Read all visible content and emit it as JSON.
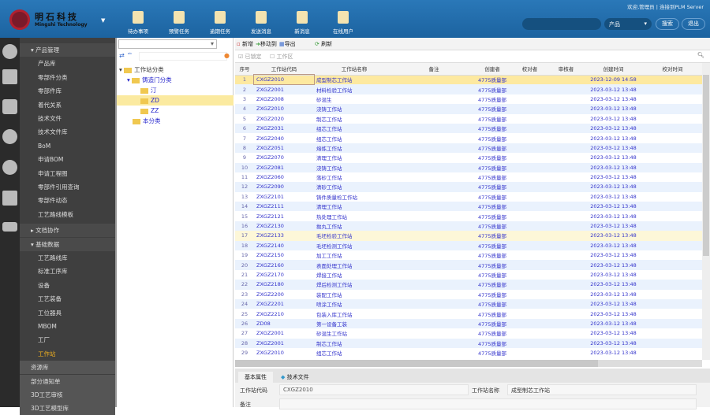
{
  "header": {
    "brand_cn": "明石科技",
    "brand_en": "Mingshi Technology",
    "welcome": "欢迎,管理员 | 连接到PLM Server",
    "toolbar": [
      {
        "label": "待办事项",
        "icon": "todo-icon"
      },
      {
        "label": "预警任务",
        "icon": "warning-doc-icon"
      },
      {
        "label": "逾期任务",
        "icon": "overdue-doc-icon"
      },
      {
        "label": "发送消息",
        "icon": "send-mail-icon"
      },
      {
        "label": "新消息",
        "icon": "new-mail-icon"
      },
      {
        "label": "在线用户",
        "icon": "users-icon"
      }
    ],
    "search_placeholder": "",
    "search_scope": "产品",
    "search_btn": "搜索",
    "exit_btn": "退出"
  },
  "menu": {
    "g1": "产品管理",
    "g1_items": [
      "产品库",
      "零部件分类",
      "零部件库",
      "着代关系",
      "技术文件",
      "技术文件库",
      "BoM",
      "申请BOM",
      "申请工程图",
      "零部件引用查询",
      "零部件动态",
      "工艺路线模板"
    ],
    "g2": "文档协作",
    "g3": "基础数据",
    "g3_items": [
      "工艺路线库",
      "标准工序库",
      "设备",
      "工艺装备",
      "工位器具",
      "MBOM",
      "工厂",
      "工作站"
    ],
    "g3_selected": "工作站",
    "g4_items": [
      "资源库",
      "部分通知单",
      "3D工艺审核",
      "3D工艺模型库"
    ]
  },
  "tree": {
    "root": "工作站分类",
    "child": "铸造门分类",
    "leaves": [
      "汀",
      "ZD",
      "ZZ"
    ],
    "selected": "ZD",
    "other": "本分类"
  },
  "toolbar": {
    "add": "新增",
    "delete": "移动到",
    "export": "导出",
    "refresh": "刷新",
    "chk1": "已锁定",
    "chk2": "工作区"
  },
  "table": {
    "columns": [
      "序号",
      "工作站代码",
      "工作站名称",
      "备注",
      "创建者",
      "校对者",
      "审核者",
      "创建时间",
      "校对时间"
    ],
    "rows": [
      [
        "1",
        "CXGZ2010",
        "成型制芯工作站",
        "",
        "4775质量部",
        "",
        "",
        "2023-12-09 14:58",
        ""
      ],
      [
        "2",
        "ZXGZ2001",
        "材料检验工作站",
        "",
        "4775质量部",
        "",
        "",
        "2023-03-12 13:48",
        ""
      ],
      [
        "3",
        "ZXGZ2008",
        "砂混生",
        "",
        "4775质量部",
        "",
        "",
        "2023-03-12 13:48",
        ""
      ],
      [
        "4",
        "ZXGZ2010",
        "浇铸工作站",
        "",
        "4775质量部",
        "",
        "",
        "2023-03-12 13:48",
        ""
      ],
      [
        "5",
        "ZXGZ2020",
        "制芯工作站",
        "",
        "4775质量部",
        "",
        "",
        "2023-03-12 13:48",
        ""
      ],
      [
        "6",
        "ZXGZ2031",
        "组芯工作站",
        "",
        "4775质量部",
        "",
        "",
        "2023-03-12 13:48",
        ""
      ],
      [
        "7",
        "ZXGZ2040",
        "组芯工作站",
        "",
        "4775质量部",
        "",
        "",
        "2023-03-12 13:48",
        ""
      ],
      [
        "8",
        "ZXGZ2051",
        "熔炼工作站",
        "",
        "4775质量部",
        "",
        "",
        "2023-03-12 13:48",
        ""
      ],
      [
        "9",
        "ZXGZ2070",
        "清理工作站",
        "",
        "4775质量部",
        "",
        "",
        "2023-03-12 13:48",
        ""
      ],
      [
        "10",
        "ZXGZ2081",
        "浇铸工作站",
        "",
        "4775质量部",
        "",
        "",
        "2023-03-12 13:48",
        ""
      ],
      [
        "11",
        "ZXGZ2060",
        "落砂工作站",
        "",
        "4775质量部",
        "",
        "",
        "2023-03-12 13:48",
        ""
      ],
      [
        "12",
        "ZXGZ2090",
        "清砂工作站",
        "",
        "4775质量部",
        "",
        "",
        "2023-03-12 13:48",
        ""
      ],
      [
        "13",
        "ZXGZ2101",
        "铸件质量检工作站",
        "",
        "4775质量部",
        "",
        "",
        "2023-03-12 13:48",
        ""
      ],
      [
        "14",
        "ZXGZ2111",
        "清理工作站",
        "",
        "4775质量部",
        "",
        "",
        "2023-03-12 13:48",
        ""
      ],
      [
        "15",
        "ZXGZ2121",
        "热处理工作站",
        "",
        "4775质量部",
        "",
        "",
        "2023-03-12 13:48",
        ""
      ],
      [
        "16",
        "ZXGZ2130",
        "抛丸工作站",
        "",
        "4775质量部",
        "",
        "",
        "2023-03-12 13:48",
        ""
      ],
      [
        "17",
        "ZXGZ2133",
        "毛坯检验工作站",
        "",
        "4775质量部",
        "",
        "",
        "2023-03-12 13:48",
        ""
      ],
      [
        "18",
        "ZXGZ2140",
        "毛坯检测工作站",
        "",
        "4775质量部",
        "",
        "",
        "2023-03-12 13:48",
        ""
      ],
      [
        "19",
        "ZXGZ2150",
        "加工工作站",
        "",
        "4775质量部",
        "",
        "",
        "2023-03-12 13:48",
        ""
      ],
      [
        "20",
        "ZXGZ2160",
        "表面处理工作站",
        "",
        "4775质量部",
        "",
        "",
        "2023-03-12 13:48",
        ""
      ],
      [
        "21",
        "ZXGZ2170",
        "焊接工作站",
        "",
        "4775质量部",
        "",
        "",
        "2023-03-12 13:48",
        ""
      ],
      [
        "22",
        "ZXGZ2180",
        "焊后检测工作站",
        "",
        "4775质量部",
        "",
        "",
        "2023-03-12 13:48",
        ""
      ],
      [
        "23",
        "ZXGZ2200",
        "装配工作站",
        "",
        "4775质量部",
        "",
        "",
        "2023-03-12 13:48",
        ""
      ],
      [
        "24",
        "ZXGZ2201",
        "喷涂工作站",
        "",
        "4775质量部",
        "",
        "",
        "2023-03-12 13:48",
        ""
      ],
      [
        "25",
        "ZXGZ2210",
        "包装入库工作站",
        "",
        "4775质量部",
        "",
        "",
        "2023-03-12 13:48",
        ""
      ],
      [
        "26",
        "ZD08",
        "第一设备工装",
        "",
        "4775质量部",
        "",
        "",
        "2023-03-12 13:48",
        ""
      ],
      [
        "27",
        "ZXGZ2001",
        "砂混生工作站",
        "",
        "4775质量部",
        "",
        "",
        "2023-03-12 13:48",
        ""
      ],
      [
        "28",
        "ZXGZ2001",
        "制芯工作站",
        "",
        "4775质量部",
        "",
        "",
        "2023-03-12 13:48",
        ""
      ],
      [
        "29",
        "ZXGZ2010",
        "组芯工作站",
        "",
        "4775质量部",
        "",
        "",
        "2023-03-12 13:48",
        ""
      ]
    ]
  },
  "detail": {
    "tab1": "基本属性",
    "tab2": "技术文件",
    "code_label": "工作站代码",
    "code_value": "CXGZ2010",
    "name_label": "工作站名称",
    "name_value": "成型制芯工作站",
    "remark_label": "备注"
  }
}
